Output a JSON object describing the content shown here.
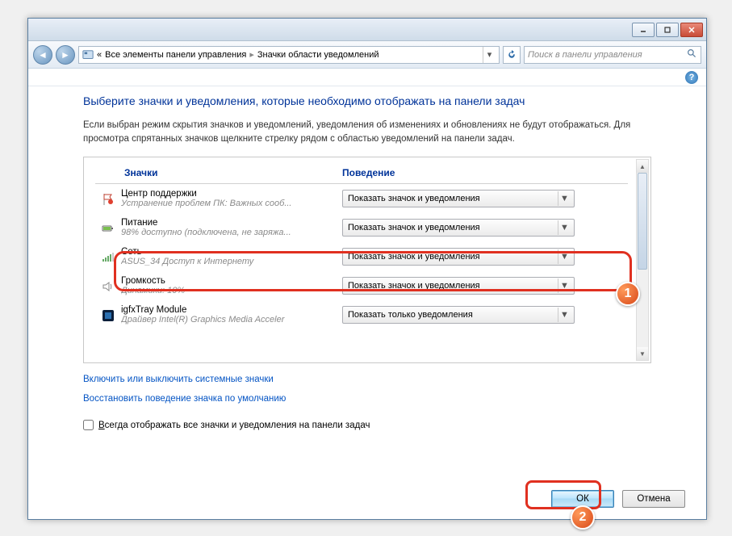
{
  "breadcrumb": {
    "prefix": "«",
    "seg1": "Все элементы панели управления",
    "seg2": "Значки области уведомлений"
  },
  "search": {
    "placeholder": "Поиск в панели управления"
  },
  "title": "Выберите значки и уведомления, которые необходимо отображать на панели задач",
  "description": "Если выбран режим скрытия значков и уведомлений, уведомления об изменениях и обновлениях не будут отображаться. Для просмотра спрятанных значков щелкните стрелку рядом с областью уведомлений на панели задач.",
  "columns": {
    "icons": "Значки",
    "behavior": "Поведение"
  },
  "rows": [
    {
      "name": "Центр поддержки",
      "sub": "Устранение проблем ПК: Важных сооб...",
      "combo": "Показать значок и уведомления"
    },
    {
      "name": "Питание",
      "sub": "98% доступно (подключена, не заряжа...",
      "combo": "Показать значок и уведомления"
    },
    {
      "name": "Сеть",
      "sub": "ASUS_34 Доступ к Интернету",
      "combo": "Показать значок и уведомления"
    },
    {
      "name": "Громкость",
      "sub": "Динамики: 10%",
      "combo": "Показать значок и уведомления"
    },
    {
      "name": "igfxTray Module",
      "sub": "Драйвер Intel(R) Graphics Media Acceler",
      "combo": "Показать только уведомления"
    }
  ],
  "links": {
    "toggle": "Включить или выключить системные значки",
    "restore": "Восстановить поведение значка по умолчанию"
  },
  "checkbox": "Всегда отображать все значки и уведомления на панели задач",
  "buttons": {
    "ok": "ОК",
    "cancel": "Отмена"
  },
  "badges": {
    "one": "1",
    "two": "2"
  }
}
